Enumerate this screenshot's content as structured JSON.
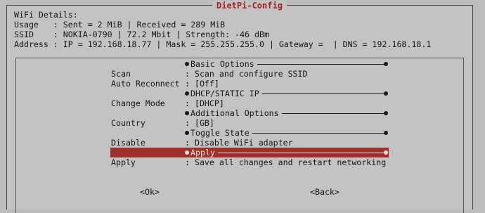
{
  "dialog": {
    "title": "DietPi-Config",
    "header_lines": [
      "WiFi Details:",
      "Usage   : Sent = 2 MiB | Received = 289 MiB",
      "SSID    : NOKIA-0790 | 72.2 Mbit | Strength: -46 dBm",
      "Address : IP = 192.168.18.77 | Mask = 255.255.255.0 | Gateway =  | DNS = 192.168.18.1"
    ]
  },
  "menu": {
    "sections": {
      "basic": "Basic Options",
      "dhcp": "DHCP/STATIC IP",
      "additional": "Additional Options",
      "toggle": "Toggle State",
      "apply": "Apply"
    },
    "items": [
      {
        "key": "Scan",
        "value": ": Scan and configure SSID"
      },
      {
        "key": "Auto Reconnect",
        "value": ": [Off]"
      },
      {
        "key": "Change Mode",
        "value": ": [DHCP]"
      },
      {
        "key": "Country",
        "value": ": [GB]"
      },
      {
        "key": "Disable",
        "value": ": Disable WiFi adapter"
      },
      {
        "key": "Apply",
        "value": ": Save all changes and restart networking"
      }
    ]
  },
  "buttons": {
    "ok": "<Ok>",
    "back": "<Back>"
  },
  "colors": {
    "title": "#a2231f",
    "selection": "#a0302b"
  }
}
